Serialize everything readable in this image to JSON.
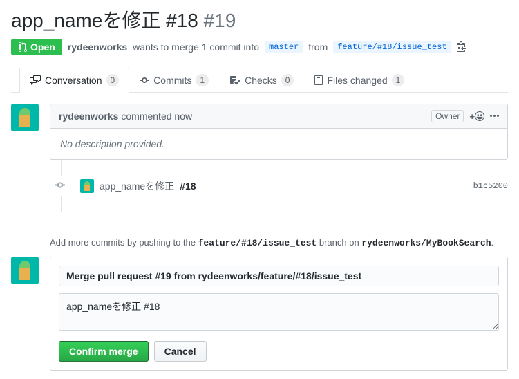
{
  "header": {
    "title": "app_nameを修正 #18",
    "pr_number": "#19",
    "state": "Open",
    "author": "rydeenworks",
    "merge_text_1": "wants to merge 1 commit into",
    "base_branch": "master",
    "merge_text_2": "from",
    "head_branch": "feature/#18/issue_test"
  },
  "tabs": {
    "conversation": {
      "label": "Conversation",
      "count": "0"
    },
    "commits": {
      "label": "Commits",
      "count": "1"
    },
    "checks": {
      "label": "Checks",
      "count": "0"
    },
    "files": {
      "label": "Files changed",
      "count": "1"
    }
  },
  "comment": {
    "author": "rydeenworks",
    "action": "commented now",
    "owner_label": "Owner",
    "body": "No description provided."
  },
  "commit": {
    "message": "app_nameを修正",
    "issue_ref": "#18",
    "sha": "b1c5200"
  },
  "hint": {
    "prefix": "Add more commits by pushing to the ",
    "branch": "feature/#18/issue_test",
    "middle": " branch on ",
    "repo": "rydeenworks/MyBookSearch",
    "suffix": "."
  },
  "merge": {
    "title_value": "Merge pull request #19 from rydeenworks/feature/#18/issue_test",
    "desc_value": "app_nameを修正 #18",
    "confirm": "Confirm merge",
    "cancel": "Cancel"
  }
}
